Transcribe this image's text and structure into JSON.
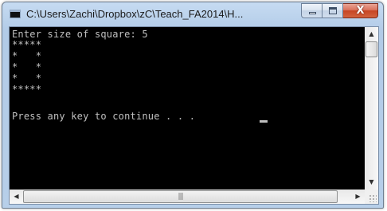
{
  "window": {
    "title": "C:\\Users\\Zachi\\Dropbox\\zC\\Teach_FA2014\\H...",
    "icon": "console-window-icon"
  },
  "caption_buttons": {
    "minimize": "minimize-icon",
    "maximize": "maximize-icon",
    "close": "close-icon",
    "close_glyph": "X"
  },
  "console": {
    "lines": [
      "Enter size of square: 5",
      "*****",
      "*   *",
      "*   *",
      "*   *",
      "*****",
      "Press any key to continue . . . "
    ],
    "text_color": "#c0c0c0",
    "background": "#000000"
  },
  "scrollbars": {
    "up_arrow": "▲",
    "down_arrow": "▼",
    "left_arrow": "◀",
    "right_arrow": "▶",
    "thumb_grip": "|||"
  }
}
